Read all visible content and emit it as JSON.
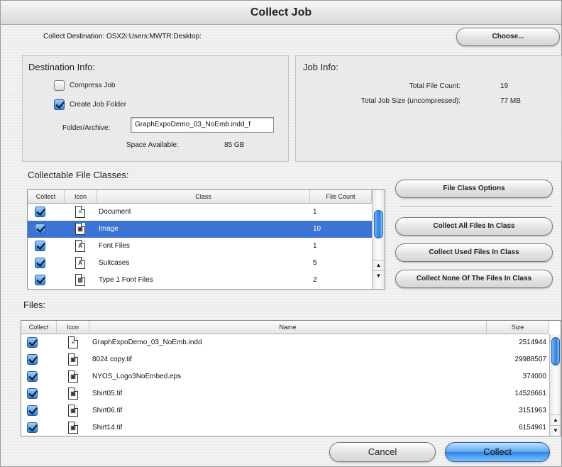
{
  "window": {
    "title": "Collect Job"
  },
  "destination": {
    "label": "Collect Destination:",
    "path": "OSX2i:Users:MWTR:Desktop:",
    "choose_label": "Choose..."
  },
  "dest_info": {
    "title": "Destination Info:",
    "compress_label": "Compress Job",
    "compress_checked": false,
    "create_folder_label": "Create Job Folder",
    "create_folder_checked": true,
    "folder_label": "Folder/Archive:",
    "folder_value": "GraphExpoDemo_03_NoEmb.indd_f",
    "space_label": "Space Available:",
    "space_value": "85 GB"
  },
  "job_info": {
    "title": "Job Info:",
    "count_label": "Total File Count:",
    "count_value": "19",
    "size_label": "Total Job Size (uncompressed):",
    "size_value": "77 MB"
  },
  "classes": {
    "title": "Collectable File Classes:",
    "headers": {
      "collect": "Collect",
      "icon": "Icon",
      "class": "Class",
      "count": "File Count"
    },
    "rows": [
      {
        "name": "Document",
        "count": "1",
        "checked": true,
        "selected": false,
        "icon": "document-icon"
      },
      {
        "name": "Image",
        "count": "10",
        "checked": true,
        "selected": true,
        "icon": "image-file-icon"
      },
      {
        "name": "Font Files",
        "count": "1",
        "checked": true,
        "selected": false,
        "icon": "font-file-icon"
      },
      {
        "name": "Suitcases",
        "count": "5",
        "checked": true,
        "selected": false,
        "icon": "suitcase-icon"
      },
      {
        "name": "Type 1 Font Files",
        "count": "2",
        "checked": true,
        "selected": false,
        "icon": "type1-font-icon"
      }
    ],
    "buttons": {
      "options": "File Class Options",
      "all": "Collect All Files In Class",
      "used": "Collect Used Files In Class",
      "none": "Collect None Of The Files In Class"
    }
  },
  "files": {
    "title": "Files:",
    "headers": {
      "collect": "Collect",
      "icon": "Icon",
      "name": "Name",
      "size": "Size"
    },
    "rows": [
      {
        "name": "GraphExpoDemo_03_NoEmb.indd",
        "size": "2514944",
        "checked": true,
        "icon": "document-icon"
      },
      {
        "name": "8024 copy.tif",
        "size": "29988507",
        "checked": true,
        "icon": "image-file-icon"
      },
      {
        "name": "NYOS_Logo3NoEmbed.eps",
        "size": "374000",
        "checked": true,
        "icon": "image-file-icon"
      },
      {
        "name": "Shirt05.tif",
        "size": "14528661",
        "checked": true,
        "icon": "image-file-icon"
      },
      {
        "name": "Shirt06.tif",
        "size": "3151963",
        "checked": true,
        "icon": "image-file-icon"
      },
      {
        "name": "Shirt14.tif",
        "size": "6154961",
        "checked": true,
        "icon": "image-file-icon"
      }
    ]
  },
  "footer": {
    "cancel": "Cancel",
    "collect": "Collect"
  },
  "colors": {
    "selection": "#3c74d6",
    "accent": "#2f86e3"
  }
}
